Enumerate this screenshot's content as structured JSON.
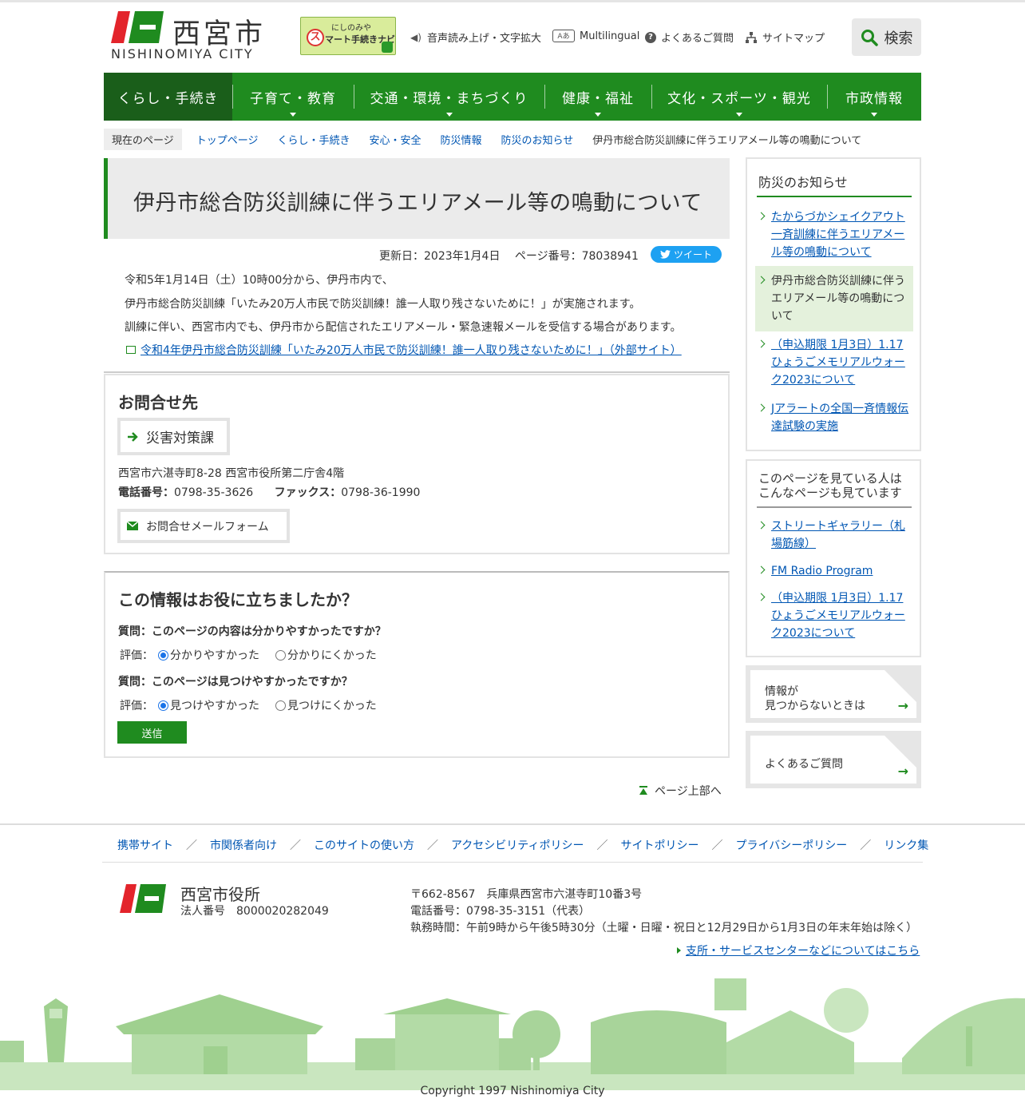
{
  "header": {
    "logo_kanji": "西宮市",
    "logo_roman": "NISHINOMIYA CITY",
    "navi_banner_line1": "にしのみや",
    "navi_banner_line2": "マート手続きナビ",
    "navi_banner_s": "ス",
    "util": {
      "voice": "音声読み上げ・文字拡大",
      "multilingual": "Multilingual",
      "faq": "よくあるご質問",
      "sitemap": "サイトマップ"
    },
    "search_label": "検索"
  },
  "nav": [
    {
      "label": "くらし・手続き"
    },
    {
      "label": "子育て・教育"
    },
    {
      "label": "交通・環境・まちづくり"
    },
    {
      "label": "健康・福祉"
    },
    {
      "label": "文化・スポーツ・観光"
    },
    {
      "label": "市政情報"
    }
  ],
  "breadcrumb": {
    "label": "現在のページ",
    "links": [
      "トップページ",
      "くらし・手続き",
      "安心・安全",
      "防災情報",
      "防災のお知らせ"
    ],
    "current": "伊丹市総合防災訓練に伴うエリアメール等の鳴動について"
  },
  "article": {
    "title": "伊丹市総合防災訓練に伴うエリアメール等の鳴動について",
    "updated": "更新日：2023年1月4日　 ページ番号：78038941",
    "tweet": "ツイート",
    "paragraphs": [
      "令和5年1月14日（土）10時00分から、伊丹市内で、",
      "伊丹市総合防災訓練「いたみ20万人市民で防災訓練！誰一人取り残さないために！」が実施されます。",
      "訓練に伴い、西宮市内でも、伊丹市から配信されたエリアメール・緊急速報メールを受信する場合があります。"
    ],
    "external_link": "令和4年伊丹市総合防災訓練「いたみ20万人市民で防災訓練！誰一人取り残さないために！」（外部サイト）"
  },
  "contact": {
    "title": "お問合せ先",
    "department": "災害対策課",
    "address": "西宮市六湛寺町8-28 西宮市役所第二庁舎4階",
    "phone_label": "電話番号：",
    "phone": "0798-35-3626",
    "fax_label": "ファックス：",
    "fax": "0798-36-1990",
    "mail_button": "お問合せメールフォーム"
  },
  "feedback": {
    "title": "この情報はお役に立ちましたか？",
    "q1": "質問：このページの内容は分かりやすかったですか？",
    "q2": "質問：このページは見つけやすかったですか？",
    "rating_label": "評価：",
    "q1_opt1": "分かりやすかった",
    "q1_opt2": "分かりにくかった",
    "q2_opt1": "見つけやすかった",
    "q2_opt2": "見つけにくかった",
    "submit": "送信"
  },
  "page_top": "ページ上部へ",
  "sidebar": {
    "news_title": "防災のお知らせ",
    "news_items": [
      {
        "label": "たからづかシェイクアウト一斉訓練に伴うエリアメール等の鳴動について",
        "active": false
      },
      {
        "label": "伊丹市総合防災訓練に伴うエリアメール等の鳴動について",
        "active": true
      },
      {
        "label": "（申込期限 1月3日）1.17ひょうごメモリアルウォーク2023について",
        "active": false
      },
      {
        "label": "Jアラートの全国一斉情報伝達試験の実施",
        "active": false
      }
    ],
    "related_title_1": "このページを見ている人は",
    "related_title_2": "こんなページも見ています",
    "related_items": [
      {
        "label": "ストリートギャラリー（札場筋線）"
      },
      {
        "label": "FM Radio Program"
      },
      {
        "label": "（申込期限 1月3日）1.17ひょうごメモリアルウォーク2023について"
      }
    ],
    "banner_notfound_1": "情報が",
    "banner_notfound_2": "見つからないときは",
    "banner_faq": "よくあるご質問"
  },
  "footer": {
    "links": [
      "携帯サイト",
      "市関係者向け",
      "このサイトの使い方",
      "アクセシビリティポリシー",
      "サイトポリシー",
      "プライバシーポリシー",
      "リンク集"
    ],
    "org": "西宮市役所",
    "corp_number": "法人番号　8000020282049",
    "address": "〒662-8567　兵庫県西宮市六湛寺町10番3号",
    "phone": "電話番号：0798-35-3151（代表）",
    "hours": "執務時間：午前9時から午後5時30分（土曜・日曜・祝日と12月29日から1月3日の年末年始は除く）",
    "branch_link": "支所・サービスセンターなどについてはこちら",
    "copyright": "Copyright 1997 Nishinomiya City"
  },
  "colors": {
    "brand_green": "#1f8b1f",
    "brand_red": "#e3242b",
    "link_blue": "#0056b3"
  }
}
